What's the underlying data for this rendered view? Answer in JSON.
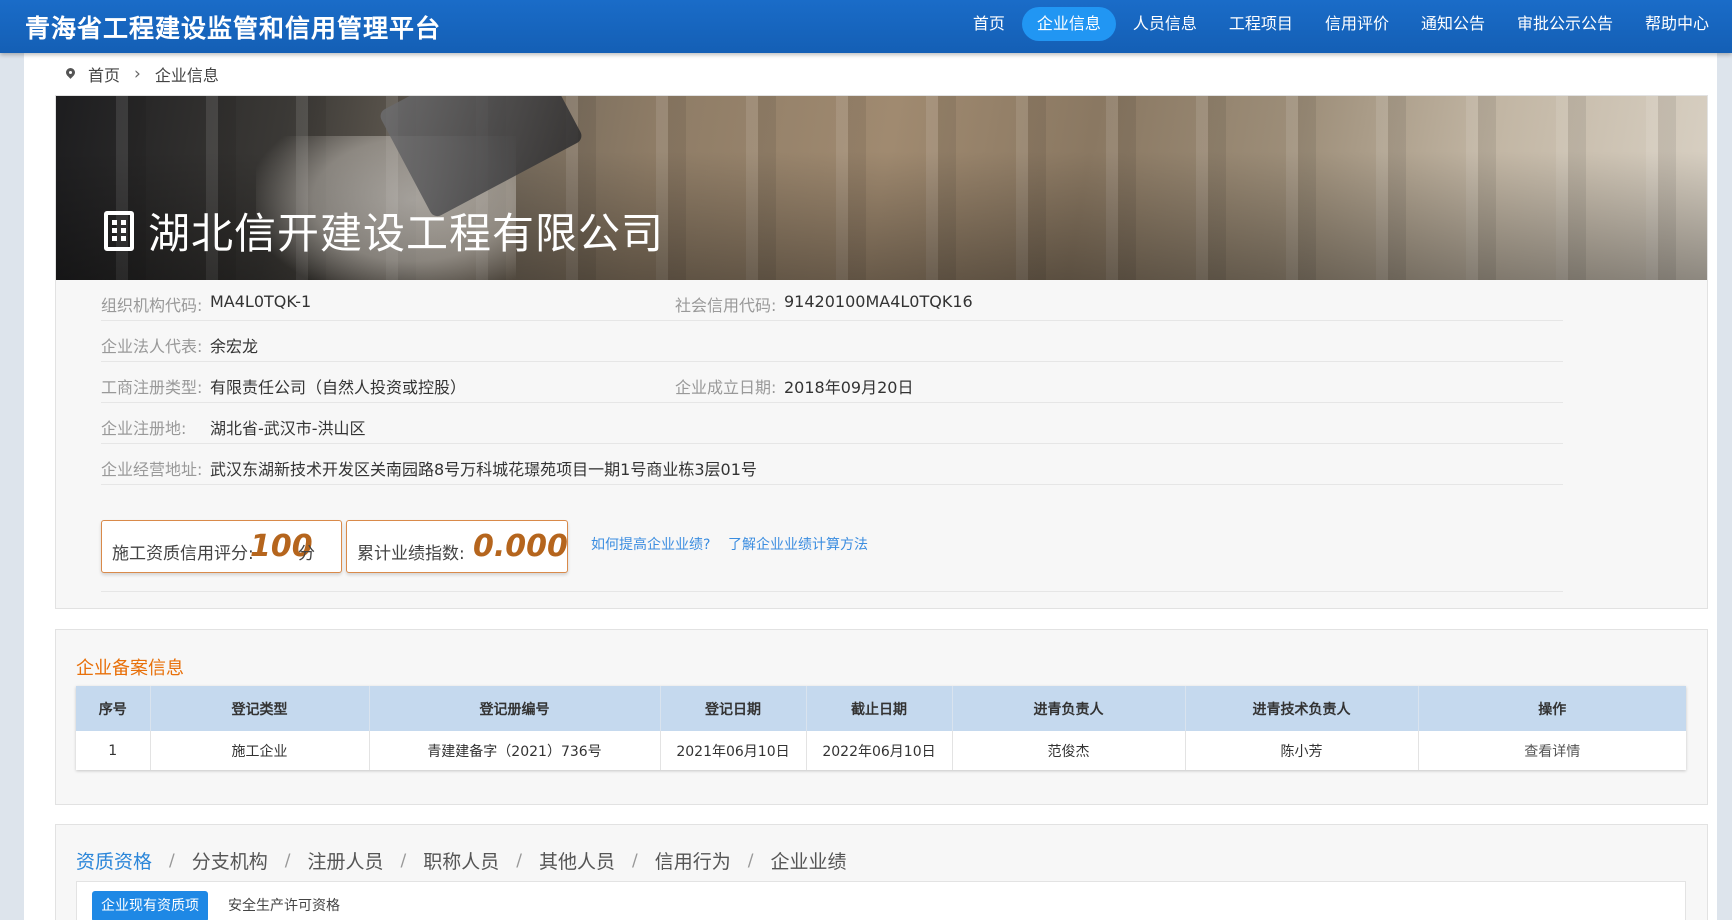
{
  "header": {
    "site_title": "青海省工程建设监管和信用管理平台",
    "nav": [
      {
        "label": "首页",
        "active": false
      },
      {
        "label": "企业信息",
        "active": true
      },
      {
        "label": "人员信息",
        "active": false
      },
      {
        "label": "工程项目",
        "active": false
      },
      {
        "label": "信用评价",
        "active": false
      },
      {
        "label": "通知公告",
        "active": false
      },
      {
        "label": "审批公示公告",
        "active": false
      },
      {
        "label": "帮助中心",
        "active": false
      }
    ]
  },
  "breadcrumb": {
    "home": "首页",
    "current": "企业信息"
  },
  "company": {
    "name": "湖北信开建设工程有限公司",
    "org_code_label": "组织机构代码:",
    "org_code": "MA4L0TQK-1",
    "credit_code_label": "社会信用代码:",
    "credit_code": "91420100MA4L0TQK16",
    "legal_rep_label": "企业法人代表:",
    "legal_rep": "余宏龙",
    "reg_type_label": "工商注册类型:",
    "reg_type": "有限责任公司（自然人投资或控股）",
    "found_date_label": "企业成立日期:",
    "found_date": "2018年09月20日",
    "reg_place_label": "企业注册地:",
    "reg_place": "湖北省-武汉市-洪山区",
    "address_label": "企业经营地址:",
    "address": "武汉东湖新技术开发区关南园路8号万科城花璟苑项目一期1号商业栋3层01号"
  },
  "scores": {
    "credit_label": "施工资质信用评分:",
    "credit_value": "100",
    "credit_unit": "分",
    "perf_label": "累计业绩指数:",
    "perf_value": "0.000",
    "link_improve": "如何提高企业业绩?",
    "link_method": "了解企业业绩计算方法"
  },
  "records": {
    "title": "企业备案信息",
    "columns": [
      "序号",
      "登记类型",
      "登记册编号",
      "登记日期",
      "截止日期",
      "进青负责人",
      "进青技术负责人",
      "操作"
    ],
    "rows": [
      [
        "1",
        "施工企业",
        "青建建备字（2021）736号",
        "2021年06月10日",
        "2022年06月10日",
        "范俊杰",
        "陈小芳",
        "查看详情"
      ]
    ]
  },
  "tabs": {
    "items": [
      {
        "label": "资质资格",
        "active": true
      },
      {
        "label": "分支机构",
        "active": false
      },
      {
        "label": "注册人员",
        "active": false
      },
      {
        "label": "职称人员",
        "active": false
      },
      {
        "label": "其他人员",
        "active": false
      },
      {
        "label": "信用行为",
        "active": false
      },
      {
        "label": "企业业绩",
        "active": false
      }
    ],
    "separator": "/",
    "subtabs": [
      {
        "label": "企业现有资质项",
        "active": true
      },
      {
        "label": "安全生产许可资格",
        "active": false
      }
    ]
  },
  "colors": {
    "header_bg": "#1565c0",
    "nav_active": "#2196f3",
    "section_title": "#e8700a",
    "score_value": "#b5651d",
    "link": "#3b8de0",
    "table_header": "#c5d9ee"
  }
}
